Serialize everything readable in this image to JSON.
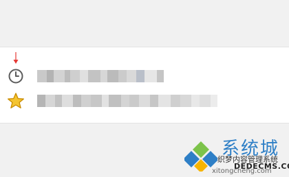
{
  "indicator": {
    "icon": "red-arrow-down-icon",
    "color": "#e53935"
  },
  "menu": {
    "items": [
      {
        "id": "history",
        "icon": "clock-icon",
        "label_obscured": true
      },
      {
        "id": "favorites",
        "icon": "star-icon",
        "label_obscured": true
      }
    ]
  },
  "watermark": {
    "brand": "系统城",
    "site_name": "织梦内容管理系统",
    "domain": "DEDECMS.COM",
    "url": "xitongcheng.com",
    "logo": "windows-logo-icon",
    "brand_color": "#2e7fc6",
    "logo_colors": [
      "#2e7fc6",
      "#7cc34a",
      "#f6b400"
    ]
  }
}
